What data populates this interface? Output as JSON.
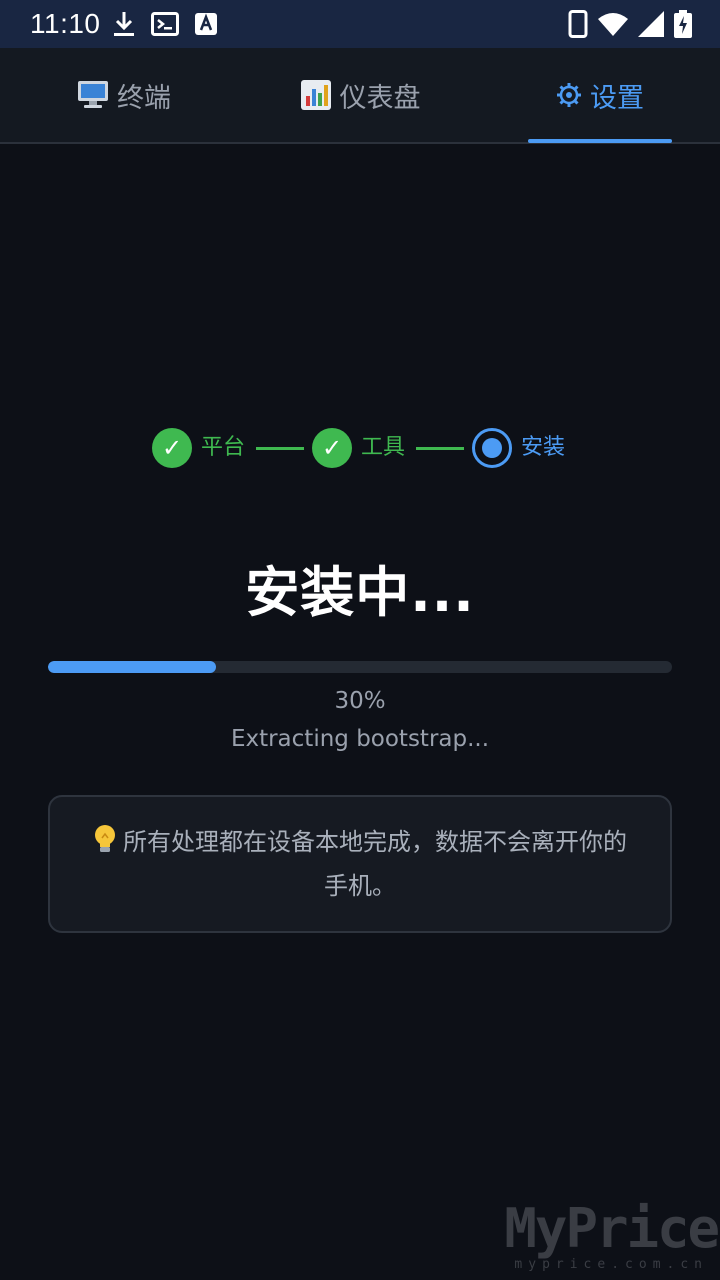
{
  "status_bar": {
    "time": "11:10",
    "left_icons": [
      "download-icon",
      "terminal-icon",
      "keyboard-a-icon"
    ],
    "right_icons": [
      "phone-icon",
      "wifi-icon",
      "signal-icon",
      "battery-charging-icon"
    ]
  },
  "tabs": [
    {
      "label": "终端",
      "icon": "desktop-computer-icon",
      "active": false
    },
    {
      "label": "仪表盘",
      "icon": "bar-chart-icon",
      "active": false
    },
    {
      "label": "设置",
      "icon": "gear-icon",
      "active": true
    }
  ],
  "stepper": {
    "steps": [
      {
        "label": "平台",
        "state": "done"
      },
      {
        "label": "工具",
        "state": "done"
      },
      {
        "label": "安装",
        "state": "current"
      }
    ],
    "check_glyph": "✓"
  },
  "heading": "安装中...",
  "progress": {
    "fraction": 0.3,
    "percent_label": "30%",
    "status": "Extracting bootstrap..."
  },
  "info_card": {
    "icon": "lightbulb-icon",
    "text": "所有处理都在设备本地完成，数据不会离开你的手机。"
  },
  "watermark": {
    "logo": "MyPrice",
    "url": "myprice.com.cn"
  },
  "colors": {
    "background": "#0d1017",
    "status_bar": "#192642",
    "accent": "#4c9bf4",
    "success": "#3fb950",
    "muted_text": "#9aa1ad"
  }
}
